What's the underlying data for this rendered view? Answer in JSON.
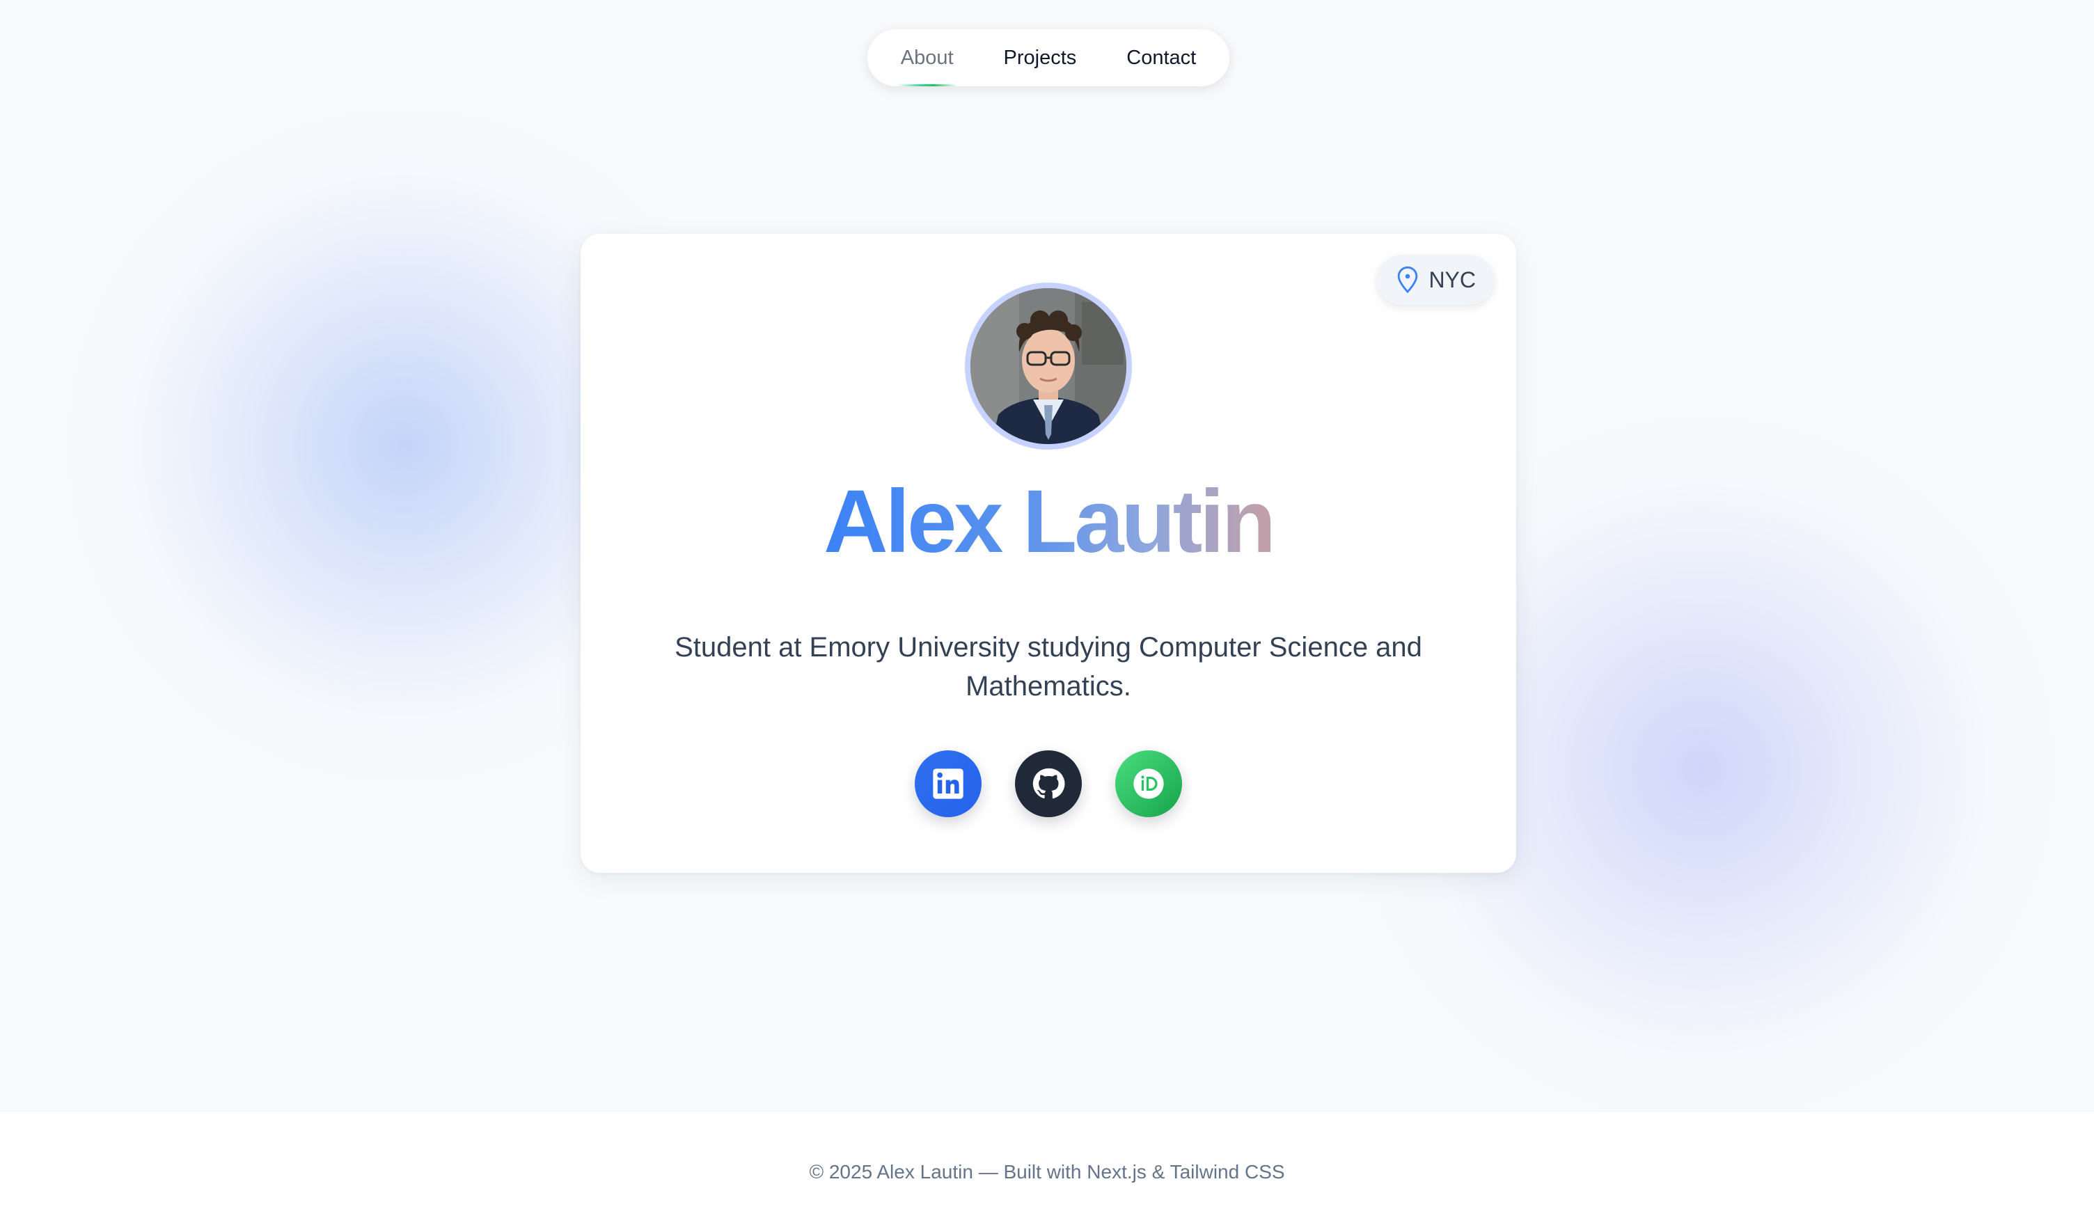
{
  "nav": {
    "items": [
      {
        "label": "About",
        "active": true
      },
      {
        "label": "Projects",
        "active": false
      },
      {
        "label": "Contact",
        "active": false
      }
    ]
  },
  "profile": {
    "location": "NYC",
    "location_icon": "map-pin-icon",
    "name": "Alex Lautin",
    "bio": "Student at Emory University studying Computer Science and Mathematics.",
    "name_gradient": [
      "#3b82f6",
      "#8ea6de",
      "#c4a0a6"
    ]
  },
  "socials": [
    {
      "icon": "linkedin-icon",
      "color": "#2563eb"
    },
    {
      "icon": "github-icon",
      "color": "#1f2937"
    },
    {
      "icon": "orcid-icon",
      "color": "#22c55e"
    }
  ],
  "footer": {
    "text": "© 2025 Alex Lautin — Built with Next.js & Tailwind CSS"
  }
}
